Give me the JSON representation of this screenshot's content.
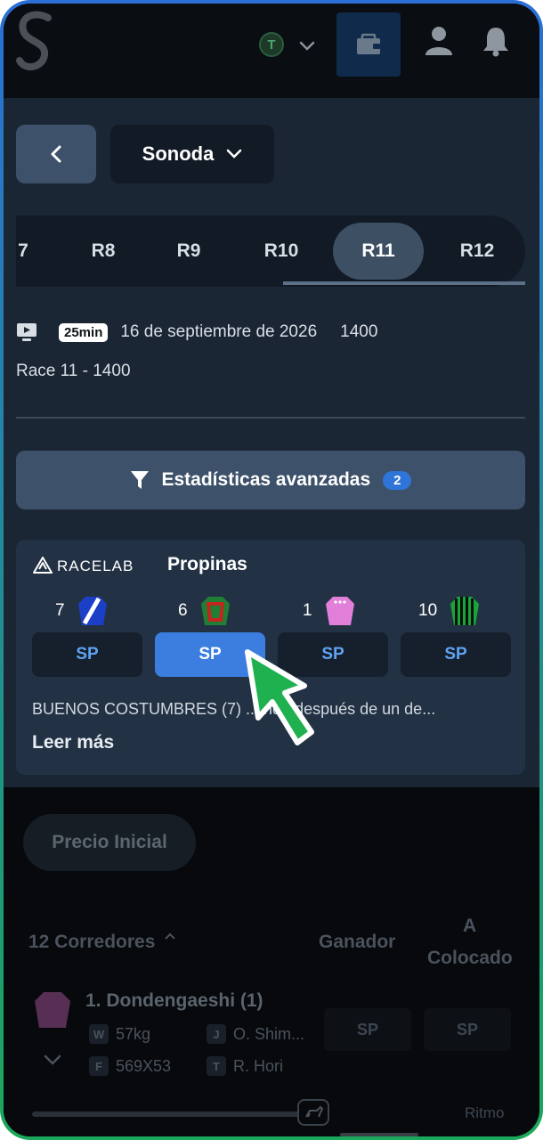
{
  "nav": {
    "token_letter": "T",
    "colors": {
      "brand_blue": "#2f74d8",
      "accent_green": "#1fb04f"
    }
  },
  "venue": {
    "name": "Sonoda"
  },
  "race_tabs": [
    "7",
    "R8",
    "R9",
    "R10",
    "R11",
    "R12"
  ],
  "active_race_tab": "R11",
  "race_info": {
    "countdown": "25min",
    "date": "16 de septiembre de 2026",
    "distance": "1400",
    "subtitle": "Race 11 - 1400"
  },
  "advanced_stats": {
    "label": "Estadísticas avanzadas",
    "count": "2"
  },
  "tips": {
    "brand": "RACELAB",
    "title": "Propinas",
    "picks": [
      {
        "number": "7",
        "silk": "blue-white-silk",
        "button": "SP"
      },
      {
        "number": "6",
        "silk": "green-red-silk",
        "button": "SP"
      },
      {
        "number": "1",
        "silk": "pink-silk",
        "button": "SP"
      },
      {
        "number": "10",
        "silk": "green-black-stripe-silk",
        "button": "SP"
      }
    ],
    "text": "BUENOS COSTUMBRES (7) ... ndo después de un de...",
    "read_more": "Leer más"
  },
  "runners_section": {
    "price_filter": "Precio Inicial",
    "count_label": "12 Corredores",
    "col_win": "Ganador",
    "col_place_line1": "A",
    "col_place_line2": "Colocado",
    "runner": {
      "name": "1. Dondengaeshi (1)",
      "weight_key": "W",
      "weight": "57kg",
      "jockey_key": "J",
      "jockey": "O. Shim...",
      "form_key": "F",
      "form": "569X53",
      "trainer_key": "T",
      "trainer": "R. Hori",
      "win_price": "SP",
      "place_price": "SP"
    },
    "pace_label": "Ritmo"
  }
}
